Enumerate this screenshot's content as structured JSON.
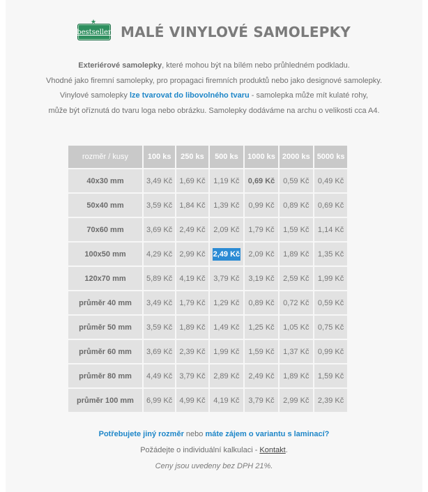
{
  "header": {
    "badge": "bestseller",
    "title": "MALÉ VINYLOVÉ SAMOLEPKY"
  },
  "intro": {
    "l1_bold": "Exteriérové samolepky",
    "l1_rest": ", které mohou být na bílém nebo průhledném podkladu.",
    "l2": "Vhodné jako firemní samolepky, pro propagaci firemních produktů nebo jako designové samolepky.",
    "l3_a": "Vinylové samolepky ",
    "l3_link": "lze tvarovat do libovolného tvaru",
    "l3_b": " - samolepka může mít kulaté rohy,",
    "l4": "může být oříznutá do tvaru loga nebo obrázku. Samolepky dodáváme na archu o velikosti cca A4."
  },
  "table": {
    "corner": "rozměr / kusy",
    "columns": [
      "100 ks",
      "250 ks",
      "500 ks",
      "1000 ks",
      "2000 ks",
      "5000 ks"
    ],
    "rows": [
      {
        "size": "40x30 mm",
        "prices": [
          "3,49 Kč",
          "1,69 Kč",
          "1,19 Kč",
          "0,69 Kč",
          "0,59 Kč",
          "0,49 Kč"
        ]
      },
      {
        "size": "50x40 mm",
        "prices": [
          "3,59 Kč",
          "1,84 Kč",
          "1,39 Kč",
          "0,99 Kč",
          "0,89 Kč",
          "0,69 Kč"
        ]
      },
      {
        "size": "70x60 mm",
        "prices": [
          "3,69 Kč",
          "2,49 Kč",
          "2,09 Kč",
          "1,79 Kč",
          "1,59 Kč",
          "1,14 Kč"
        ]
      },
      {
        "size": "100x50 mm",
        "prices": [
          "4,29 Kč",
          "2,99 Kč",
          "2,49 Kč",
          "2,09 Kč",
          "1,89 Kč",
          "1,35 Kč"
        ]
      },
      {
        "size": "120x70 mm",
        "prices": [
          "5,89 Kč",
          "4,19 Kč",
          "3,79 Kč",
          "3,19 Kč",
          "2,59 Kč",
          "1,99 Kč"
        ]
      },
      {
        "size": "průměr 40 mm",
        "prices": [
          "3,49 Kč",
          "1,79 Kč",
          "1,29 Kč",
          "0,89 Kč",
          "0,72 Kč",
          "0,59 Kč"
        ]
      },
      {
        "size": "průměr 50 mm",
        "prices": [
          "3,59 Kč",
          "1,89 Kč",
          "1,49 Kč",
          "1,25 Kč",
          "1,05 Kč",
          "0,75 Kč"
        ]
      },
      {
        "size": "průměr 60 mm",
        "prices": [
          "3,69 Kč",
          "2,39 Kč",
          "1,99 Kč",
          "1,59 Kč",
          "1,37 Kč",
          "0,99 Kč"
        ]
      },
      {
        "size": "průměr 80 mm",
        "prices": [
          "4,49 Kč",
          "3,79 Kč",
          "2,89 Kč",
          "2,49 Kč",
          "1,89 Kč",
          "1,59 Kč"
        ]
      },
      {
        "size": "průměr 100 mm",
        "prices": [
          "6,99 Kč",
          "4,99 Kč",
          "4,19 Kč",
          "3,79 Kč",
          "2,99 Kč",
          "2,39 Kč"
        ]
      }
    ]
  },
  "footer": {
    "link1": "Potřebujete jiný rozměr",
    "mid": " nebo ",
    "link2": "máte zájem o variantu s laminací?",
    "l2_text": "Požádejte o individuální kalkulaci - ",
    "l2_link": "Kontakt",
    "l2_end": ".",
    "note": "Ceny jsou uvedeny bez DPH 21%."
  },
  "colors": {
    "accent": "#1e86c8",
    "highlight": "#2b8bd4",
    "header_cell": "#c9c9c9",
    "body_cell": "#e2e2e2",
    "badge": "#2f8f5f"
  }
}
